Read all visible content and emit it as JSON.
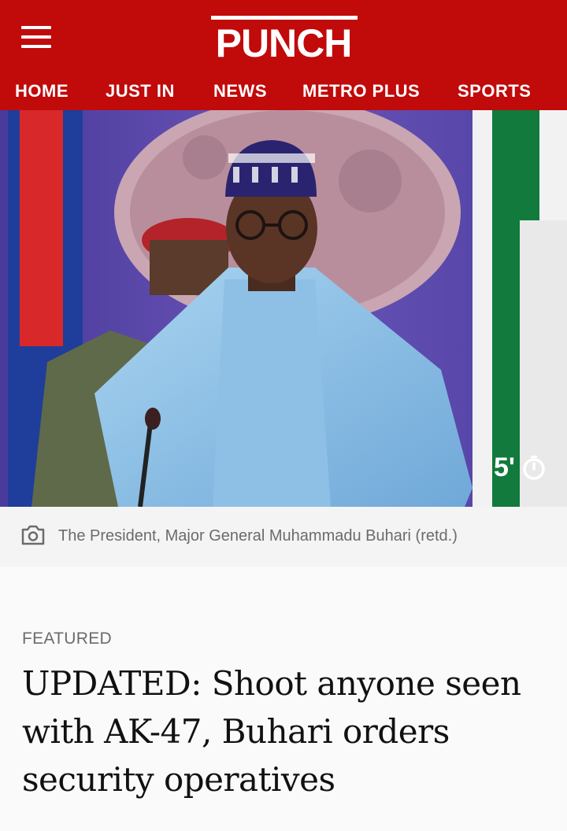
{
  "header": {
    "logo_text": "PUNCH",
    "brand_color": "#c10a0a",
    "menu_icon": "hamburger-menu-icon"
  },
  "nav": {
    "items": [
      {
        "label": "HOME"
      },
      {
        "label": "JUST IN"
      },
      {
        "label": "NEWS"
      },
      {
        "label": "METRO PLUS"
      },
      {
        "label": "SPORTS"
      }
    ]
  },
  "hero": {
    "read_time": "5'",
    "read_time_icon": "stopwatch-icon"
  },
  "caption": {
    "icon": "camera-icon",
    "text": "The President, Major General Muhammadu Buhari (retd.)"
  },
  "article": {
    "category": "FEATURED",
    "headline": "UPDATED: Shoot anyone seen with AK-47, Buhari orders security operatives"
  }
}
